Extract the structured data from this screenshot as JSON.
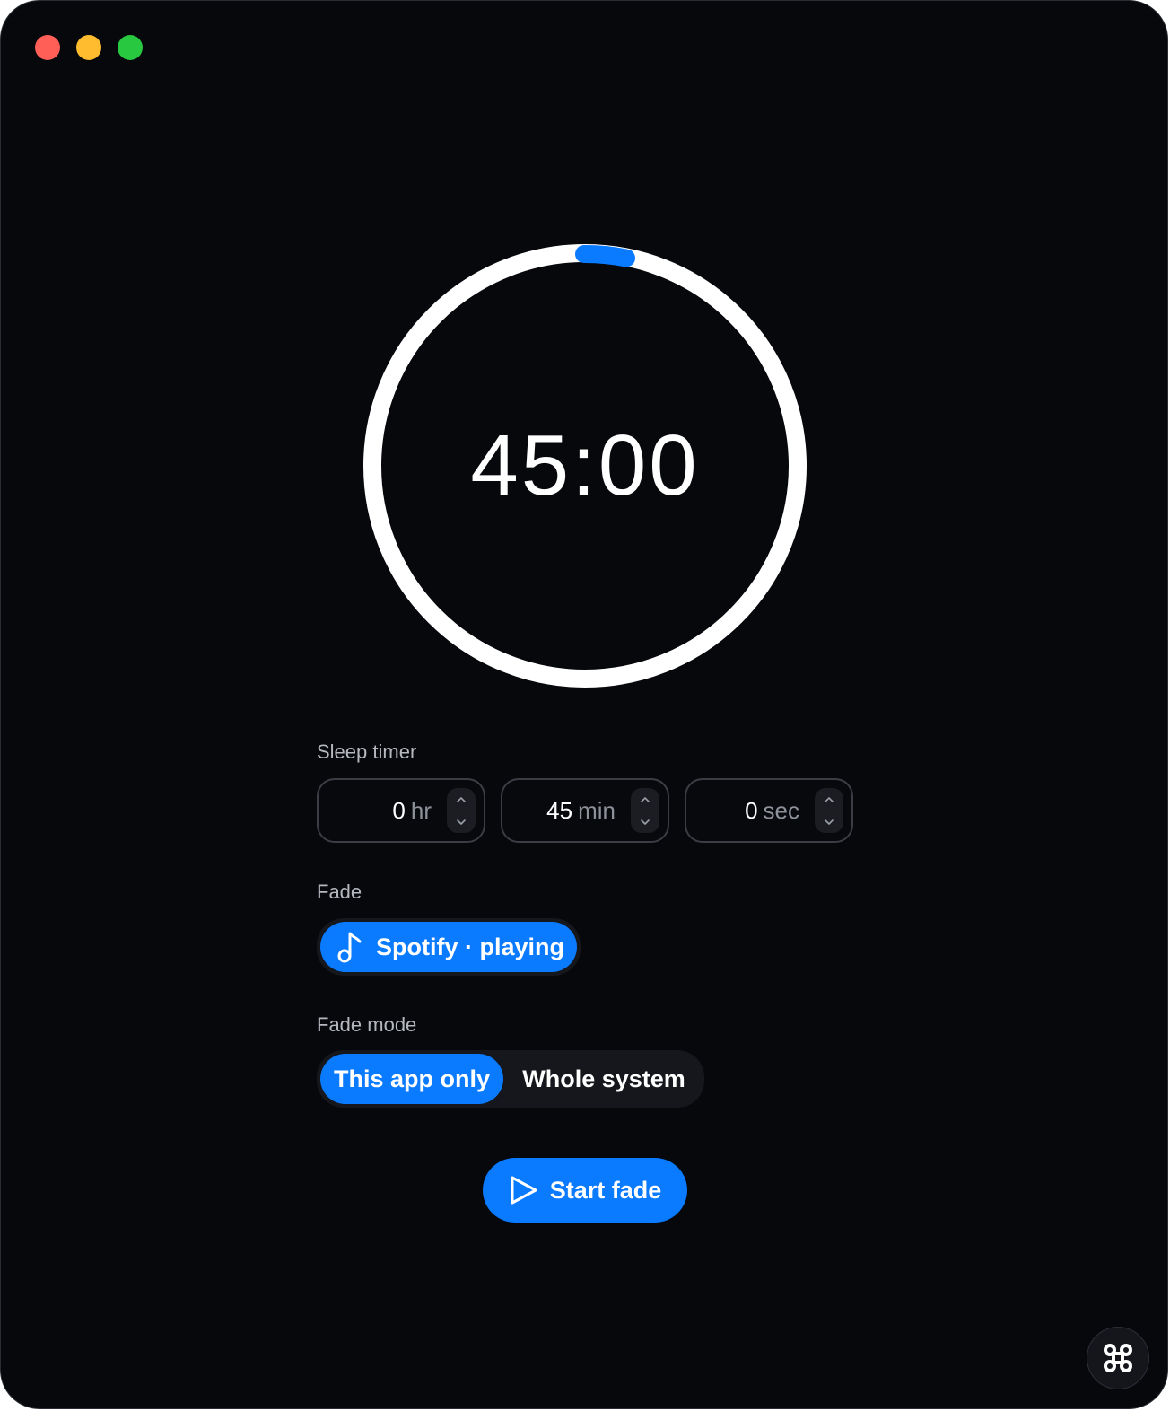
{
  "window": {
    "traffic_lights": [
      "close",
      "minimize",
      "maximize"
    ]
  },
  "timer": {
    "display": "45:00",
    "progress": 0.0
  },
  "sleep_timer": {
    "label": "Sleep timer",
    "hours": {
      "value": "0",
      "unit": "hr"
    },
    "minutes": {
      "value": "45",
      "unit": "min"
    },
    "seconds": {
      "value": "0",
      "unit": "sec"
    }
  },
  "fade": {
    "label": "Fade",
    "source": {
      "label": "Spotify · playing",
      "icon": "music-note-icon"
    }
  },
  "fade_mode": {
    "label": "Fade mode",
    "options": [
      "This app only",
      "Whole system"
    ],
    "selected": "This app only"
  },
  "start": {
    "label": "Start fade",
    "icon": "play-icon"
  },
  "corner_button": {
    "icon": "command-icon"
  },
  "colors": {
    "background": "#06080c",
    "accent": "#0a7aff",
    "ring": "#ffffff",
    "muted_text": "#b5b8bf"
  }
}
